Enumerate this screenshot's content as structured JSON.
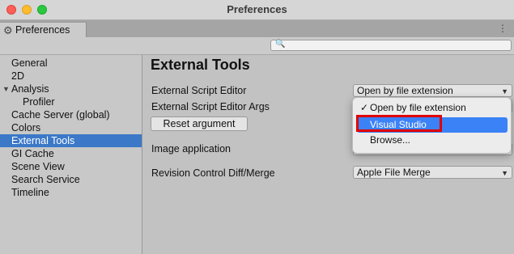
{
  "window": {
    "title": "Preferences"
  },
  "tab": {
    "label": "Preferences",
    "icon": "gear-icon"
  },
  "search": {
    "placeholder": ""
  },
  "sidebar": {
    "items": [
      {
        "label": "General"
      },
      {
        "label": "2D"
      },
      {
        "label": "Analysis"
      },
      {
        "label": "Profiler"
      },
      {
        "label": "Cache Server (global)"
      },
      {
        "label": "Colors"
      },
      {
        "label": "External Tools"
      },
      {
        "label": "GI Cache"
      },
      {
        "label": "Scene View"
      },
      {
        "label": "Search Service"
      },
      {
        "label": "Timeline"
      }
    ]
  },
  "main": {
    "heading": "External Tools",
    "script_editor_label": "External Script Editor",
    "script_editor_value": "Open by file extension",
    "script_editor_args_label": "External Script Editor Args",
    "reset_button": "Reset argument",
    "image_app_label": "Image application",
    "revision_label": "Revision Control Diff/Merge",
    "revision_value": "Apple File Merge"
  },
  "menu": {
    "items": [
      {
        "label": "Open by file extension",
        "checked": true
      },
      {
        "label": "Visual Studio",
        "highlighted": true
      },
      {
        "label": "Browse..."
      }
    ]
  },
  "colors": {
    "selection": "#3b78c8",
    "highlight": "#3b82f6",
    "annotation": "#e00000"
  }
}
